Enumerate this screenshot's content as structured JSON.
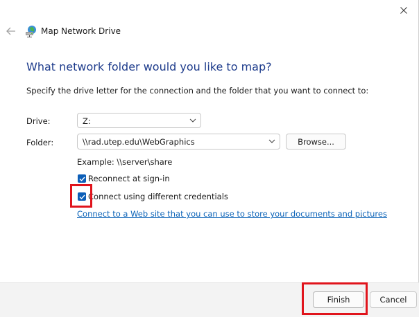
{
  "window": {
    "title": "Map Network Drive",
    "close_icon": "close-icon",
    "back_icon": "back-arrow-icon",
    "title_icon": "network-drive-icon"
  },
  "main": {
    "heading": "What network folder would you like to map?",
    "instructions": "Specify the drive letter for the connection and the folder that you want to connect to:",
    "drive_label": "Drive:",
    "drive_value": "Z:",
    "folder_label": "Folder:",
    "folder_value": "\\\\rad.utep.edu\\WebGraphics",
    "browse_label": "Browse...",
    "example": "Example: \\\\server\\share",
    "reconnect_label": "Reconnect at sign-in",
    "reconnect_checked": true,
    "credentials_label": "Connect using different credentials",
    "credentials_checked": true,
    "link_text": "Connect to a Web site that you can use to store your documents and pictures",
    "link_suffix": "."
  },
  "footer": {
    "finish_label": "Finish",
    "cancel_label": "Cancel"
  },
  "colors": {
    "heading": "#1e3c8c",
    "accent": "#0d5fb8",
    "link": "#0b63b8",
    "highlight": "#e0141c"
  }
}
